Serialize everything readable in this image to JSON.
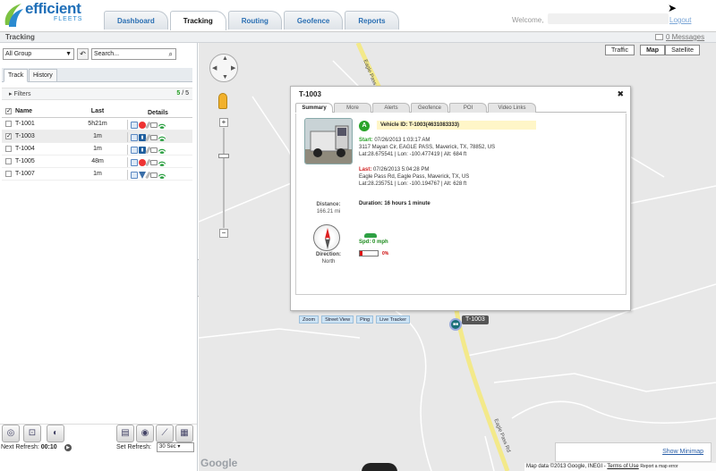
{
  "app": {
    "logo_word": "efficient",
    "logo_sub": "FLEETS",
    "tabs": [
      "Dashboard",
      "Tracking",
      "Routing",
      "Geofence",
      "Reports"
    ],
    "active_tab": "Tracking",
    "welcome_label": "Welcome,",
    "logout_label": "Logout",
    "page_title": "Tracking",
    "messages_label": "0 Messages"
  },
  "panel": {
    "group_select_value": "All Group",
    "search_placeholder": "Search...",
    "subtabs": [
      "Track",
      "History"
    ],
    "filters_label": "Filters",
    "filters_shown": "5",
    "filters_total": "5",
    "columns": {
      "name": "Name",
      "last": "Last",
      "details": "Details"
    },
    "vehicles": [
      {
        "name": "T-1001",
        "last": "5h21m",
        "checked": false,
        "icons": [
          "doc-icon",
          "red-dot-icon",
          "wrench-icon",
          "mail-icon",
          "signal-icon"
        ]
      },
      {
        "name": "T-1003",
        "last": "1m",
        "checked": true,
        "icons": [
          "doc-icon",
          "engine-icon",
          "wrench-icon",
          "mail-icon",
          "signal-icon"
        ]
      },
      {
        "name": "T-1004",
        "last": "1m",
        "checked": false,
        "icons": [
          "doc-icon",
          "engine-icon",
          "wrench-icon",
          "mail-icon",
          "signal-icon"
        ]
      },
      {
        "name": "T-1005",
        "last": "48m",
        "checked": false,
        "icons": [
          "doc-icon",
          "red-dot-icon",
          "wrench-icon",
          "mail-icon",
          "signal-icon"
        ]
      },
      {
        "name": "T-1007",
        "last": "1m",
        "checked": false,
        "icons": [
          "doc-icon",
          "direction-arrow-icon",
          "wrench-icon",
          "mail-icon",
          "signal-icon"
        ]
      }
    ],
    "next_refresh_label": "Next Refresh:",
    "next_refresh_value": "00:10",
    "set_refresh_label": "Set Refresh:",
    "refresh_select_value": "30 Sec"
  },
  "map": {
    "road_label_top": "Eagle Pass Rd",
    "road_label_bottom": "Eagle Pass Rd",
    "maptype_traffic": "Traffic",
    "maptype_map": "Map",
    "maptype_satellite": "Satellite",
    "marker_label": "T-1003",
    "show_minimap": "Show Minimap",
    "google_logo": "Google",
    "attribution": "Map data ©2013 Google, INEGI -",
    "terms": "Terms of Use",
    "report_error": "Report a map error"
  },
  "info": {
    "title": "T-1003",
    "tabs": [
      "Summary",
      "More",
      "Alerts",
      "Geofence",
      "POI",
      "Video Links"
    ],
    "status_letter": "A",
    "vehicle_id": "Vehicle ID: T-1003(4631083333)",
    "start_label": "Start:",
    "start_time": " 07/26/2013 1:03:17 AM",
    "start_address": "3117 Mayan Cir, EAGLE PASS, Maverick, TX, 78852, US",
    "start_coords": "Lat:28.675541 | Lon: -100.477419  | Alt: 684 ft",
    "last_label": "Last:",
    "last_time": " 07/26/2013 5:04:28 PM",
    "last_address": "Eagle Pass Rd, Eagle Pass, Maverick, TX, US",
    "last_coords": "Lat:28.235751 | Lon: -100.194767 | Alt: 628 ft",
    "duration": "Duration: 16 hours 1 minute",
    "distance_label": "Distance:",
    "distance_value": "166.21 mi",
    "direction_label": "Direction:",
    "direction_value": "North",
    "speed": "Spd: 0 mph",
    "fuel_percent": "0%",
    "fuel_fraction": 0.0,
    "actions": [
      "Zoom",
      "Street View",
      "Ping",
      "Live Tracker"
    ]
  }
}
